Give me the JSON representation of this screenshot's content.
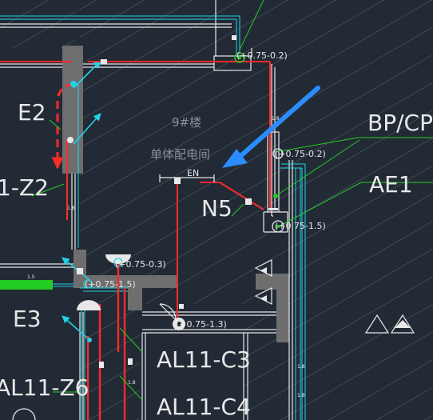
{
  "room": {
    "name_line1": "9#楼",
    "name_line2": "单体配电间"
  },
  "labels": {
    "e2": "E2",
    "z2": "1-Z2",
    "e3": "E3",
    "z6": "AL11-Z6",
    "c3": "AL11-C3",
    "c4": "AL11-C4",
    "bpcp": "BP/CP",
    "ae1": "AE1",
    "n5": "N5",
    "en": "EN"
  },
  "heights": {
    "top": "(+0.75-0.2)",
    "bp": "(+0.75-0.2)",
    "ae1": "(+0.75-1.5)",
    "mid": "(+0.75-0.3)",
    "low": "(+0.75-1.5)",
    "bottom": "(+0.75-1.3)"
  },
  "tiny": {
    "t1": "1.5",
    "t2": "1.8",
    "t3": "1.8",
    "t4": "1.8",
    "t5": "1.8",
    "t6": "1.8"
  },
  "colors": {
    "background": "#222a35",
    "wall": "#6e6e6e",
    "hatch": "#5a6470",
    "red_wire": "#ff2a2a",
    "green_leader": "#22cc22",
    "cyan": "#22d3e6",
    "white": "#e8e8e8",
    "blue_arrow": "#2a8cff"
  }
}
